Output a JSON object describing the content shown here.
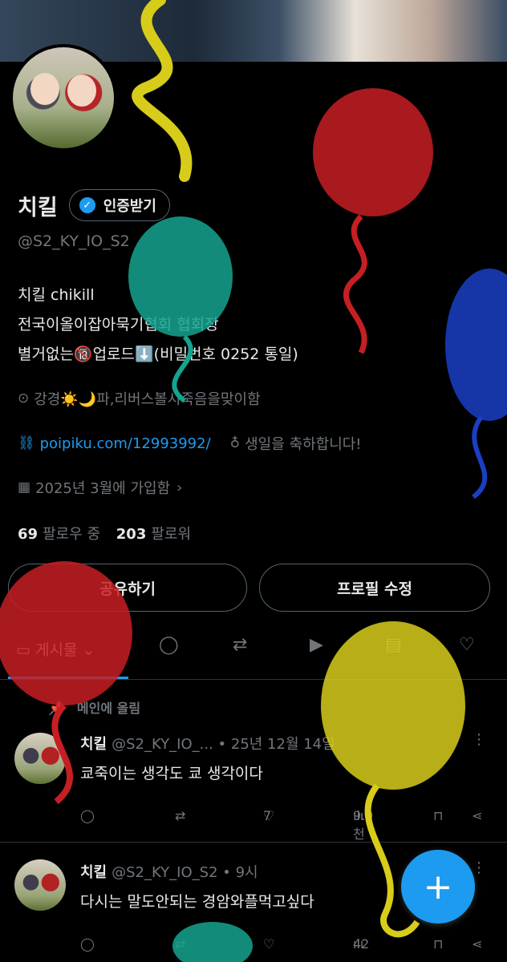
{
  "profile": {
    "name": "치킬",
    "verify_label": "인증받기",
    "handle": "@S2_KY_IO_S2",
    "bio_lines": [
      "치킬 chikill",
      "전국이올이잡아묵기협회 협회장",
      "별거없는🔞업로드⬇️(비밀번호 0252 통일)"
    ],
    "location": "강경☀️🌙파,리버스볼시죽음을맞이함",
    "website": "poipiku.com/12993992/",
    "birthday": "생일을 축하합니다!",
    "joined": "2025년 3월에 가입함",
    "following_count": "69",
    "following_label": "팔로우 중",
    "followers_count": "203",
    "followers_label": "팔로워"
  },
  "buttons": {
    "share": "공유하기",
    "edit_profile": "프로필 수정"
  },
  "tabs": {
    "posts_label": "게시물"
  },
  "pinned_label": "메인에 올림",
  "posts": [
    {
      "name": "치킬",
      "meta": "@S2_KY_IO_... • 25년 12월 14일",
      "text": "쿄죽이는 생각도 쿄 생각이다",
      "likes": "7",
      "views": "9.9천"
    },
    {
      "name": "치킬",
      "meta": "@S2_KY_IO_S2 • 9시",
      "text": "다시는 말도안되는 경암와플먹고싶다",
      "views": "42"
    }
  ],
  "colors": {
    "accent": "#1d9bf0",
    "background": "#000000",
    "muted": "#71767b"
  }
}
